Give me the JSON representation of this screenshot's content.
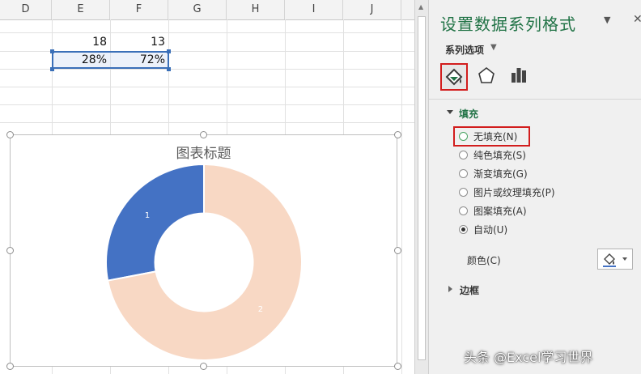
{
  "columns": [
    "D",
    "E",
    "F",
    "G",
    "H",
    "I",
    "J"
  ],
  "cells": {
    "e1": "18",
    "f1": "13",
    "e2": "28%",
    "f2": "72%"
  },
  "chart": {
    "title": "图表标题",
    "label_1": "1",
    "label_2": "2"
  },
  "chart_data": {
    "type": "pie",
    "title": "图表标题",
    "categories": [
      "1",
      "2"
    ],
    "values": [
      0.28,
      0.72
    ],
    "hole": 0.5,
    "colors": [
      "#4472c4",
      "#f8d8c4"
    ]
  },
  "pane": {
    "title": "设置数据系列格式",
    "series_options": "系列选项",
    "fill_section": "填充",
    "options": [
      {
        "label": "无填充(N)",
        "selected": false
      },
      {
        "label": "纯色填充(S)",
        "selected": false
      },
      {
        "label": "渐变填充(G)",
        "selected": false
      },
      {
        "label": "图片或纹理填充(P)",
        "selected": false
      },
      {
        "label": "图案填充(A)",
        "selected": false
      },
      {
        "label": "自动(U)",
        "selected": true
      }
    ],
    "color_label": "颜色(C)",
    "border_section": "边框"
  },
  "watermark": "头条 @Excel学习世界",
  "colors": {
    "accent": "#217346",
    "highlight": "#d21d1d",
    "series_blue": "#4472c4",
    "series_peach": "#f8d8c4"
  }
}
